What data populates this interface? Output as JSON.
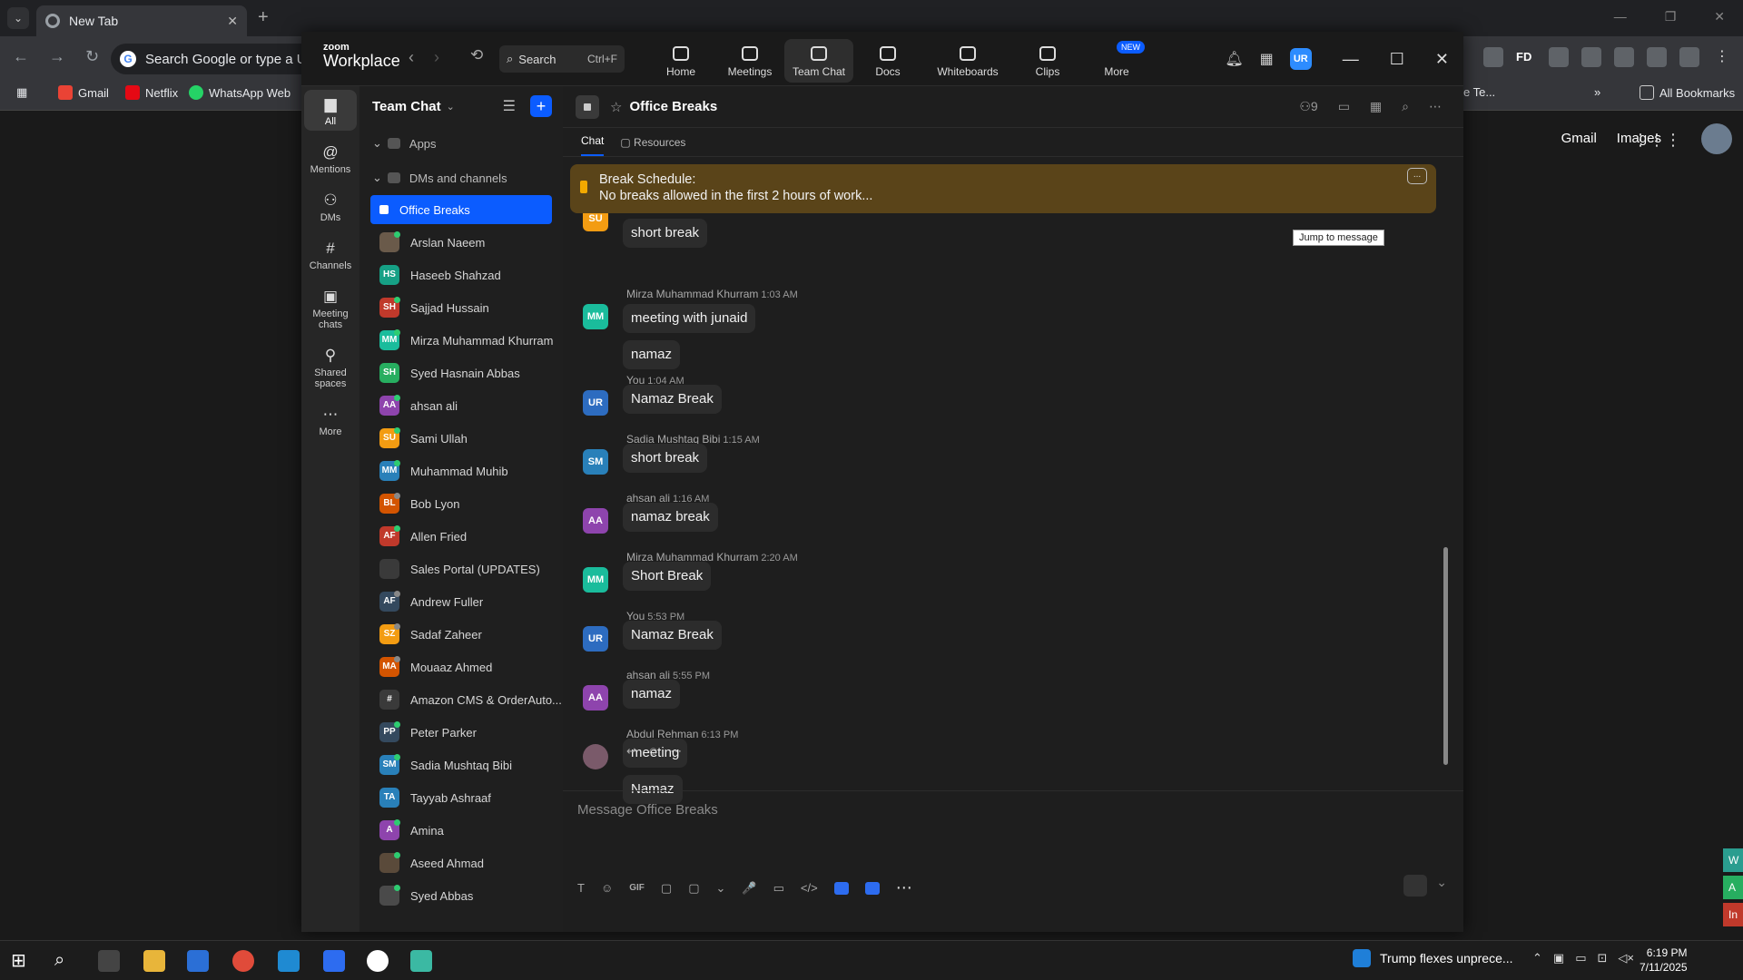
{
  "browser": {
    "tab_title": "New Tab",
    "omnibox_placeholder": "Search Google or type a URL",
    "bookmarks": [
      "Gmail",
      "Netflix",
      "WhatsApp Web"
    ],
    "bookmarks_partial": "e Te...",
    "all_bookmarks": "All Bookmarks",
    "google_links": [
      "Gmail",
      "Images"
    ],
    "side_chips": [
      "W",
      "A",
      "In"
    ],
    "ext_fd": "FD"
  },
  "zoom": {
    "brand_top": "zoom",
    "brand_bottom": "Workplace",
    "search_label": "Search",
    "search_shortcut": "Ctrl+F",
    "tabs": [
      {
        "label": "Home",
        "icon": "home-icon"
      },
      {
        "label": "Meetings",
        "icon": "video-camera-icon"
      },
      {
        "label": "Team Chat",
        "icon": "chat-bubble-icon"
      },
      {
        "label": "Docs",
        "icon": "document-icon"
      },
      {
        "label": "Whiteboards",
        "icon": "whiteboard-icon"
      },
      {
        "label": "Clips",
        "icon": "clips-icon"
      },
      {
        "label": "More",
        "icon": "more-icon"
      }
    ],
    "more_badge": "NEW",
    "user_initials": "UR",
    "rail": [
      {
        "label": "All",
        "icon": "chat-icon"
      },
      {
        "label": "Mentions",
        "icon": "at-icon"
      },
      {
        "label": "DMs",
        "icon": "people-icon"
      },
      {
        "label": "Channels",
        "icon": "hash-icon"
      },
      {
        "label": "Meeting chats",
        "icon": "calendar-icon"
      },
      {
        "label": "Shared spaces",
        "icon": "share-icon"
      },
      {
        "label": "More",
        "icon": "more-icon"
      }
    ],
    "list": {
      "title": "Team Chat",
      "sec_apps": "Apps",
      "sec_dms": "DMs and channels",
      "active_channel": "Office Breaks",
      "items": [
        {
          "name": "Arslan Naeem",
          "initials": "",
          "color": "#6a5a4a",
          "status": "#2ecc71"
        },
        {
          "name": "Haseeb Shahzad",
          "initials": "HS",
          "color": "#16a085",
          "status": ""
        },
        {
          "name": "Sajjad Hussain",
          "initials": "SH",
          "color": "#c0392b",
          "status": "#2ecc71"
        },
        {
          "name": "Mirza Muhammad Khurram",
          "initials": "MM",
          "color": "#1abc9c",
          "status": "#2ecc71"
        },
        {
          "name": "Syed Hasnain Abbas",
          "initials": "SH",
          "color": "#27ae60",
          "status": ""
        },
        {
          "name": "ahsan ali",
          "initials": "AA",
          "color": "#8e44ad",
          "status": "#2ecc71"
        },
        {
          "name": "Sami Ullah",
          "initials": "SU",
          "color": "#f39c12",
          "status": "#2ecc71"
        },
        {
          "name": "Muhammad Muhib",
          "initials": "MM",
          "color": "#2980b9",
          "status": "#2ecc71"
        },
        {
          "name": "Bob Lyon",
          "initials": "BL",
          "color": "#d35400",
          "status": "#888888"
        },
        {
          "name": "Allen Fried",
          "initials": "AF",
          "color": "#c0392b",
          "status": "#2ecc71"
        },
        {
          "name": "Sales Portal (UPDATES)",
          "initials": "",
          "color": "#3a3a3a",
          "status": ""
        },
        {
          "name": "Andrew Fuller",
          "initials": "AF",
          "color": "#34495e",
          "status": "#888888"
        },
        {
          "name": "Sadaf Zaheer",
          "initials": "SZ",
          "color": "#f39c12",
          "status": "#888888"
        },
        {
          "name": "Mouaaz Ahmed",
          "initials": "MA",
          "color": "#d35400",
          "status": "#888888"
        },
        {
          "name": "Amazon CMS & OrderAuto...",
          "initials": "#",
          "color": "#3a3a3a",
          "status": ""
        },
        {
          "name": "Peter Parker",
          "initials": "PP",
          "color": "#34495e",
          "status": "#2ecc71"
        },
        {
          "name": "Sadia Mushtaq Bibi",
          "initials": "SM",
          "color": "#2980b9",
          "status": "#2ecc71"
        },
        {
          "name": "Tayyab Ashraaf",
          "initials": "TA",
          "color": "#2980b9",
          "status": ""
        },
        {
          "name": "Amina",
          "initials": "A",
          "color": "#8e44ad",
          "status": "#2ecc71"
        },
        {
          "name": "Aseed Ahmad",
          "initials": "",
          "color": "#5a4a3a",
          "status": "#2ecc71"
        },
        {
          "name": "Syed Abbas",
          "initials": "",
          "color": "#4a4a4a",
          "status": "#2ecc71"
        }
      ]
    },
    "chat": {
      "channel_name": "Office Breaks",
      "members_count": "9",
      "tabs": [
        "Chat",
        "Resources"
      ],
      "pinned_title": "Break Schedule:",
      "pinned_text": "No breaks allowed in the first 2 hours of work...",
      "pinned_more": "...",
      "jump_to_message": "Jump to message",
      "composer_placeholder": "Message Office Breaks",
      "messages": [
        {
          "author": "",
          "time": "",
          "initials": "SU",
          "color": "#f39c12",
          "bubbles": [
            "short break"
          ]
        },
        {
          "author": "Mirza Muhammad Khurram",
          "time": "1:03 AM",
          "initials": "MM",
          "color": "#1abc9c",
          "bubbles": [
            "meeting with junaid",
            "namaz"
          ]
        },
        {
          "author": "You",
          "time": "1:04 AM",
          "initials": "UR",
          "color": "#2d6cc0",
          "bubbles": [
            "Namaz Break"
          ]
        },
        {
          "author": "Sadia Mushtaq Bibi",
          "time": "1:15 AM",
          "initials": "SM",
          "color": "#2980b9",
          "bubbles": [
            "short break"
          ]
        },
        {
          "author": "ahsan ali",
          "time": "1:16 AM",
          "initials": "AA",
          "color": "#8e44ad",
          "bubbles": [
            "namaz break"
          ]
        },
        {
          "author": "Mirza Muhammad Khurram",
          "time": "2:20 AM",
          "initials": "MM",
          "color": "#1abc9c",
          "bubbles": [
            "Short Break"
          ]
        },
        {
          "author": "You",
          "time": "5:53 PM",
          "initials": "UR",
          "color": "#2d6cc0",
          "bubbles": [
            "Namaz Break"
          ]
        },
        {
          "author": "ahsan ali",
          "time": "5:55 PM",
          "initials": "AA",
          "color": "#8e44ad",
          "bubbles": [
            "namaz"
          ]
        },
        {
          "author": "Abdul Rehman",
          "time": "6:13 PM",
          "initials": "",
          "color": "#7a5a6a",
          "bubbles": [
            "meeting",
            "Namaz"
          ]
        }
      ],
      "tools": [
        "T",
        "☺",
        "GIF",
        "▢",
        "▢",
        "⌄",
        "🎤",
        "▭",
        "</>"
      ]
    }
  },
  "taskbar": {
    "news": "Trump flexes unprece...",
    "time": "6:19 PM",
    "date": "7/11/2025"
  }
}
